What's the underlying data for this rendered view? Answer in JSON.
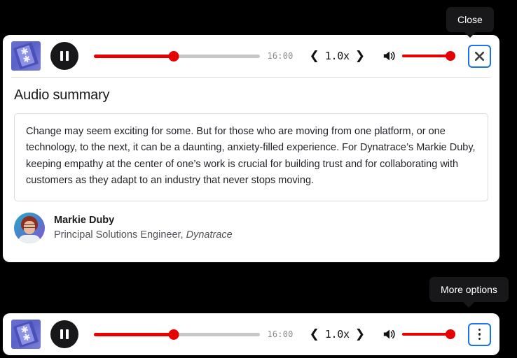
{
  "page": {
    "background_color": "#000000",
    "card_background": "#ffffff"
  },
  "colors": {
    "accent_red": "#e60000",
    "focus_blue": "#1a73e8",
    "tooltip_bg": "#18181a",
    "track_gray": "#c7c7c7"
  },
  "tooltips": {
    "close": "Close",
    "more_options": "More options"
  },
  "player_top": {
    "thumbnail_alt": "episode-artwork",
    "play_pause_label": "Pause",
    "progress": {
      "percent": 48,
      "time_remaining": "16:00"
    },
    "speed": {
      "decrease_icon": "❮",
      "value": "1.0x",
      "increase_icon": "❯"
    },
    "volume": {
      "percent": 100,
      "icon": "volume-high-icon"
    },
    "action_button": {
      "name": "close-button",
      "icon": "close-icon"
    }
  },
  "summary": {
    "title": "Audio summary",
    "text": "Change may seem exciting for some. But for those who are moving from one platform, or one technology, to the next, it can be a daunting, anxiety-filled experience. For Dynatrace’s Markie Duby, keeping empathy at the center of one’s work is crucial for building trust and for collaborating with customers as they adapt to an industry that never stops moving.",
    "author": {
      "name": "Markie Duby",
      "role": "Principal Solutions Engineer, ",
      "organization": "Dynatrace",
      "avatar_alt": "markie-duby-portrait"
    }
  },
  "player_bottom": {
    "thumbnail_alt": "episode-artwork",
    "play_pause_label": "Pause",
    "progress": {
      "percent": 48,
      "time_remaining": "16:00"
    },
    "speed": {
      "decrease_icon": "❮",
      "value": "1.0x",
      "increase_icon": "❯"
    },
    "volume": {
      "percent": 100,
      "icon": "volume-high-icon"
    },
    "action_button": {
      "name": "more-options-button",
      "icon": "kebab-menu-icon"
    }
  }
}
